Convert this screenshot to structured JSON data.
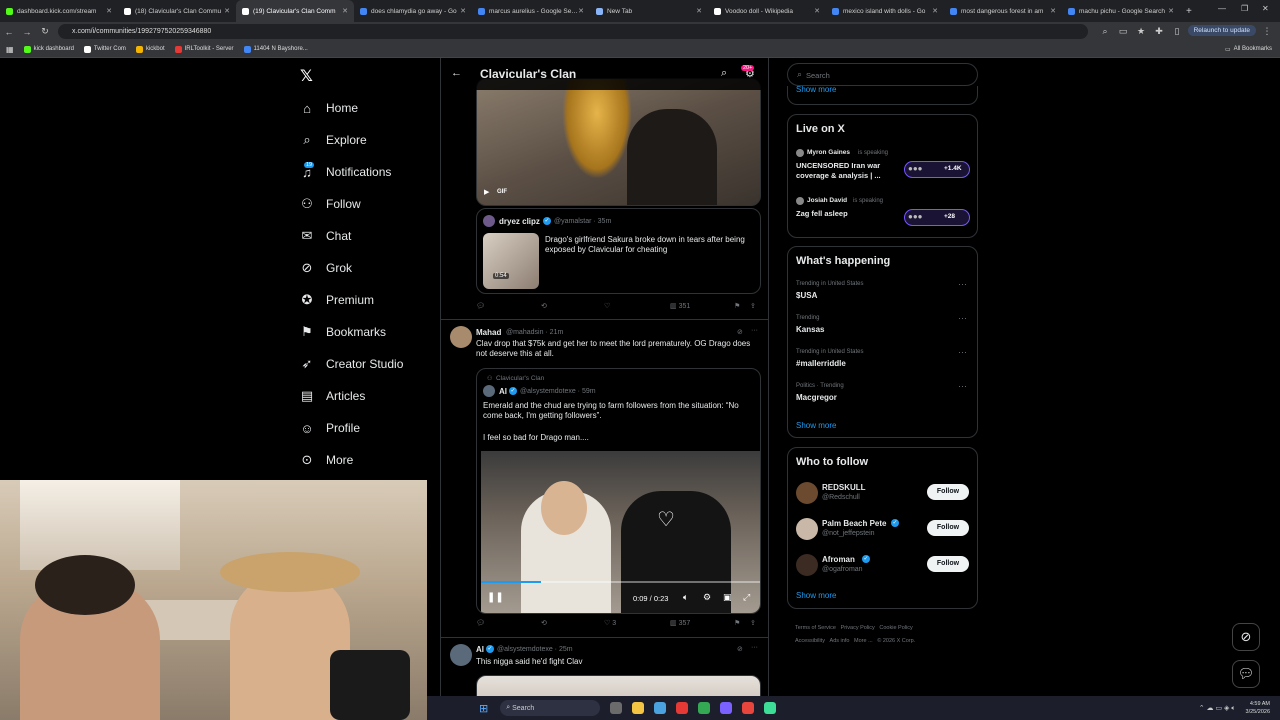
{
  "browser": {
    "tabs": [
      {
        "title": "dashboard.kick.com/stream",
        "color": "#53fc18"
      },
      {
        "title": "(18) Clavicular's Clan Commu",
        "color": "#ffffff"
      },
      {
        "title": "(19) Clavicular's Clan Comm",
        "color": "#ffffff",
        "active": true
      },
      {
        "title": "does chlamydia go away - Go",
        "color": "#4285f4"
      },
      {
        "title": "marcus aurelius - Google Searc",
        "color": "#4285f4"
      },
      {
        "title": "New Tab",
        "color": "#8ab4f8"
      },
      {
        "title": "Voodoo doll - Wikipedia",
        "color": "#ffffff"
      },
      {
        "title": "mexico island with dolls - Go",
        "color": "#4285f4"
      },
      {
        "title": "most dangerous forest in am",
        "color": "#4285f4"
      },
      {
        "title": "machu pichu - Google Search",
        "color": "#4285f4"
      }
    ],
    "url": "x.com/i/communities/1992797520259346880",
    "relaunch": "Relaunch to update",
    "bookmarks": [
      {
        "label": "kick dashboard",
        "color": "#53fc18"
      },
      {
        "label": "Twitter Com",
        "color": "#ffffff"
      },
      {
        "label": "kickbot",
        "color": "#f4b400"
      },
      {
        "label": "IRLToolkit - Server",
        "color": "#e53935"
      },
      {
        "label": "11404 N Bayshore...",
        "color": "#4285f4"
      }
    ],
    "all_bookmarks": "All Bookmarks"
  },
  "nav": {
    "items": [
      {
        "label": "Home",
        "icon": "home-icon",
        "glyph": "⌂"
      },
      {
        "label": "Explore",
        "icon": "search-icon",
        "glyph": "⌕"
      },
      {
        "label": "Notifications",
        "icon": "bell-icon",
        "glyph": "♫"
      },
      {
        "label": "Follow",
        "icon": "person-plus-icon",
        "glyph": "⚇"
      },
      {
        "label": "Chat",
        "icon": "mail-icon",
        "glyph": "✉"
      },
      {
        "label": "Grok",
        "icon": "grok-icon",
        "glyph": "⊘"
      },
      {
        "label": "Premium",
        "icon": "verified-icon",
        "glyph": "✪"
      },
      {
        "label": "Bookmarks",
        "icon": "bookmark-icon",
        "glyph": "⚑"
      },
      {
        "label": "Creator Studio",
        "icon": "rocket-icon",
        "glyph": "➶"
      },
      {
        "label": "Articles",
        "icon": "article-icon",
        "glyph": "▤"
      },
      {
        "label": "Profile",
        "icon": "profile-icon",
        "glyph": "☺"
      },
      {
        "label": "More",
        "icon": "more-icon",
        "glyph": "⊙"
      }
    ],
    "notif_badge": "19"
  },
  "header": {
    "title": "Clavicular's Clan",
    "badge": "20+"
  },
  "feed": {
    "gif_label": "GIF",
    "quote1": {
      "name": "dryez clipz",
      "handle": "@yamalstar · 35m",
      "text": "Drago's girlfriend Sakura broke down in tears after being exposed by Clavicular for cheating",
      "duration": "0:54"
    },
    "actions1": {
      "views": "351"
    },
    "post2": {
      "name": "Mahad",
      "handle": "@mahadsin · 21m",
      "text": "Clav drop that $75k and get her to meet the lord prematurely. OG Drago does not deserve this at all.",
      "community": "Clavicular's Clan",
      "quote_name": "Al",
      "quote_handle": "@alsystemdotexe · 59m",
      "quote_text1": "Emerald and the chud are trying to farm followers from the situation: “No come back, I'm getting followers”.",
      "quote_text2": "I feel so bad for Drago man....",
      "video_time": "0:09 / 0:23"
    },
    "actions2": {
      "likes": "3",
      "views": "357"
    },
    "post3": {
      "name": "Al",
      "handle": "@alsystemdotexe · 25m",
      "text": "This nigga said he'd fight Clav"
    }
  },
  "right": {
    "search_placeholder": "Search",
    "show_more_top": "Show more",
    "live_title": "Live on X",
    "live": [
      {
        "host": "Myron Gaines",
        "status": "is speaking",
        "title": "UNCENSORED Iran war coverage & analysis | ...",
        "count": "+1.4K"
      },
      {
        "host": "Josiah David",
        "status": "is speaking",
        "title": "Zag fell asleep",
        "count": "+28"
      }
    ],
    "happening_title": "What's happening",
    "trends": [
      {
        "meta": "Trending in United States",
        "name": "$USA"
      },
      {
        "meta": "Trending",
        "name": "Kansas"
      },
      {
        "meta": "Trending in United States",
        "name": "#mallerriddle"
      },
      {
        "meta": "Politics · Trending",
        "name": "Macgregor"
      }
    ],
    "show_more": "Show more",
    "wtf_title": "Who to follow",
    "follow": [
      {
        "name": "REDSKULL",
        "handle": "@Redschull",
        "verified": false
      },
      {
        "name": "Palm Beach Pete",
        "handle": "@not_jeffepstein",
        "verified": true
      },
      {
        "name": "Afroman",
        "handle": "@ogafroman",
        "verified": true
      }
    ],
    "follow_label": "Follow",
    "show_more_follow": "Show more",
    "footer1": [
      "Terms of Service",
      "Privacy Policy",
      "Cookie Policy"
    ],
    "footer2": [
      "Accessibility",
      "Ads info",
      "More ...",
      "© 2026 X Corp."
    ]
  },
  "taskbar": {
    "search": "Search",
    "time": "4:59 AM",
    "date": "3/25/2026"
  },
  "colors": {
    "accent": "#1d9bf0",
    "bg": "#000000",
    "border": "#2f3336"
  }
}
